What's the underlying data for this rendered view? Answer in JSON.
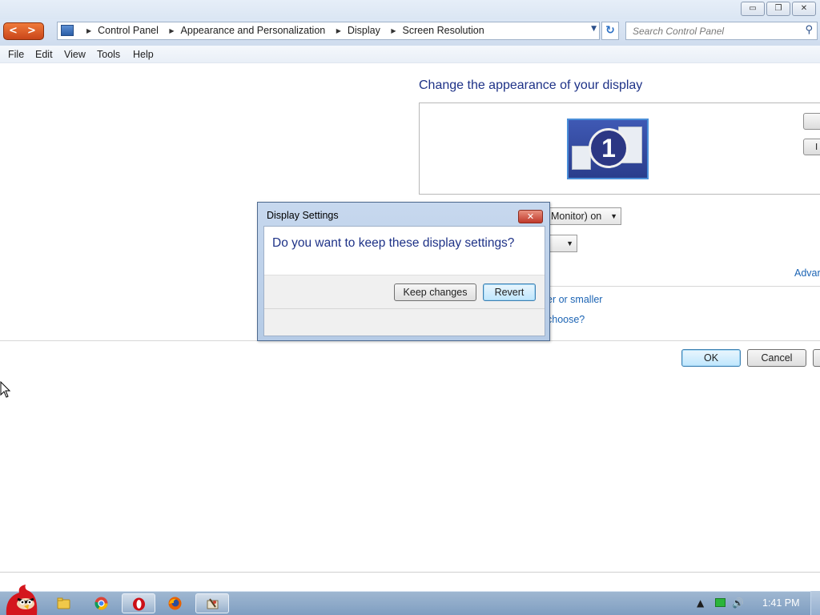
{
  "window": {
    "controls": {
      "minimize": "▭",
      "restore": "❐",
      "close": "✕"
    }
  },
  "address_bar": {
    "breadcrumbs": [
      "Control Panel",
      "Appearance and Personalization",
      "Display",
      "Screen Resolution"
    ],
    "search_placeholder": "Search Control Panel"
  },
  "menu": [
    "File",
    "Edit",
    "View",
    "Tools",
    "Help"
  ],
  "main": {
    "heading": "Change the appearance of your display",
    "monitor_number": "1",
    "detect_btn_partial": "",
    "identify_btn_partial": "I",
    "display_combo_partial": "Monitor) on",
    "advanced_link_partial": "Advar",
    "link_text_size_partial": "er or smaller",
    "link_choose_partial": "choose?",
    "ok_label": "OK",
    "cancel_label": "Cancel"
  },
  "dialog": {
    "title": "Display Settings",
    "close_glyph": "✕",
    "message": "Do you want to keep these display settings?",
    "keep_label": "Keep changes",
    "revert_label": "Revert"
  },
  "taskbar": {
    "icons": [
      "angry-birds-start-icon",
      "folder-icon",
      "chrome-icon",
      "opera-icon",
      "firefox-icon",
      "control-panel-icon"
    ],
    "clock": "1:41 PM"
  },
  "colors": {
    "heading_blue": "#1e3287",
    "link_blue": "#1c64b4",
    "taskbar": "#8aa6c7"
  }
}
